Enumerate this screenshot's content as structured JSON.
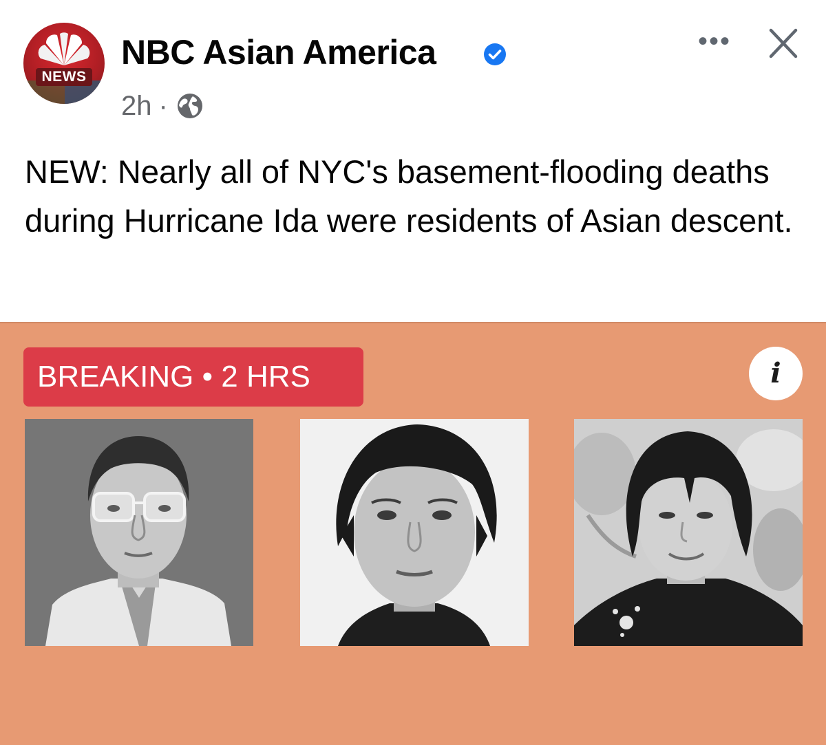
{
  "post": {
    "page_name": "NBC Asian America",
    "badge": "NEWS",
    "time": "2h",
    "separator": "·",
    "more_label": "•••",
    "text": "NEW: Nearly all of NYC's basement-flooding deaths during Hurricane Ida were residents of Asian descent."
  },
  "card": {
    "breaking_label": "BREAKING • 2 HRS",
    "info_label": "i",
    "background_color": "#e79a73",
    "breaking_color": "#dc3c48"
  },
  "icons": {
    "verified": "verified-check-icon",
    "audience": "globe-icon",
    "more": "more-options-icon",
    "close": "close-icon",
    "info": "info-icon"
  }
}
